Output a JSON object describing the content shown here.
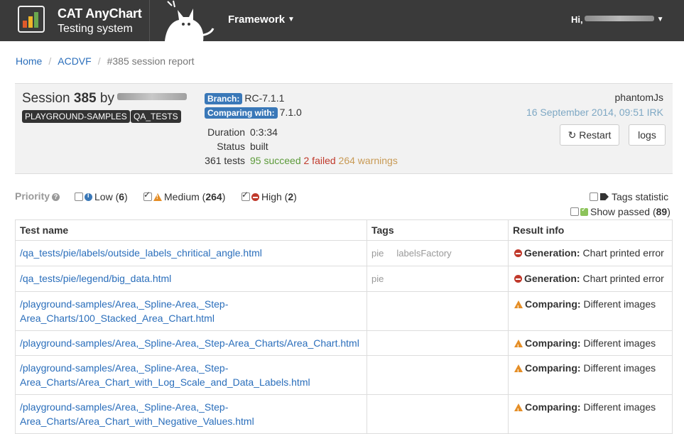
{
  "navbar": {
    "brand_title": "CAT AnyChart",
    "brand_subtitle": "Testing system",
    "menu_framework": "Framework",
    "greeting": "Hi,",
    "colors": {
      "bg": "#3a3a3a",
      "logo_bars": [
        "#e05a2b",
        "#f0b429",
        "#6aa84f"
      ]
    }
  },
  "breadcrumb": {
    "home": "Home",
    "project": "ACDVF",
    "current": "#385 session report"
  },
  "session": {
    "title_prefix": "Session",
    "number": "385",
    "by": "by",
    "tags": [
      "PLAYGROUND-SAMPLES",
      "QA_TESTS"
    ],
    "branch_label": "Branch:",
    "branch_value": "RC-7.1.1",
    "comparing_label": "Comparing with:",
    "comparing_value": "7.1.0",
    "duration_label": "Duration",
    "duration_value": "0:3:34",
    "status_label": "Status",
    "status_value": "built",
    "tests_count": "361 tests",
    "succeed": "95 succeed",
    "failed": "2 failed",
    "warnings": "264 warnings",
    "engine": "phantomJs",
    "date": "16 September 2014, 09:51 IRK",
    "restart_label": "Restart",
    "logs_label": "logs"
  },
  "filters": {
    "priority_label": "Priority",
    "low_label": "Low",
    "low_count": "6",
    "medium_label": "Medium",
    "medium_count": "264",
    "high_label": "High",
    "high_count": "2",
    "tags_statistic_label": "Tags statistic",
    "show_passed_label": "Show passed",
    "show_passed_count": "89"
  },
  "table": {
    "headers": [
      "Test name",
      "Tags",
      "Result info"
    ],
    "rows": [
      {
        "name": "/qa_tests/pie/labels/outside_labels_chritical_angle.html",
        "tags": [
          "pie",
          "labelsFactory"
        ],
        "result_type": "error",
        "result_bold": "Generation:",
        "result_text": "Chart printed error"
      },
      {
        "name": "/qa_tests/pie/legend/big_data.html",
        "tags": [
          "pie"
        ],
        "result_type": "error",
        "result_bold": "Generation:",
        "result_text": "Chart printed error"
      },
      {
        "name": "/playground-samples/Area,_Spline-Area,_Step-Area_Charts/100_Stacked_Area_Chart.html",
        "tags": [],
        "result_type": "warning",
        "result_bold": "Comparing:",
        "result_text": "Different images"
      },
      {
        "name": "/playground-samples/Area,_Spline-Area,_Step-Area_Charts/Area_Chart.html",
        "tags": [],
        "result_type": "warning",
        "result_bold": "Comparing:",
        "result_text": "Different images"
      },
      {
        "name": "/playground-samples/Area,_Spline-Area,_Step-Area_Charts/Area_Chart_with_Log_Scale_and_Data_Labels.html",
        "tags": [],
        "result_type": "warning",
        "result_bold": "Comparing:",
        "result_text": "Different images"
      },
      {
        "name": "/playground-samples/Area,_Spline-Area,_Step-Area_Charts/Area_Chart_with_Negative_Values.html",
        "tags": [],
        "result_type": "warning",
        "result_bold": "Comparing:",
        "result_text": "Different images"
      }
    ]
  }
}
